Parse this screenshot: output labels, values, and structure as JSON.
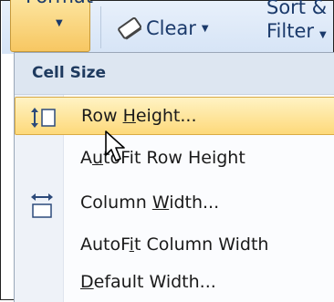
{
  "ribbon": {
    "format_label": "Format",
    "clear_label": "Clear",
    "sort_filter_line1": "Sort &",
    "sort_filter_line2": "Filter"
  },
  "menu": {
    "section_title": "Cell Size",
    "items": [
      {
        "pre": "Row ",
        "ul": "H",
        "post": "eight...",
        "highlighted": true,
        "icon": "row-height-icon"
      },
      {
        "pre": "A",
        "ul": "u",
        "post": "toFit Row Height",
        "highlighted": false,
        "icon": null
      },
      {
        "pre": "Column ",
        "ul": "W",
        "post": "idth...",
        "highlighted": false,
        "icon": "column-width-icon"
      },
      {
        "pre": "AutoF",
        "ul": "i",
        "post": "t Column Width",
        "highlighted": false,
        "icon": null
      },
      {
        "pre": "",
        "ul": "D",
        "post": "efault Width...",
        "highlighted": false,
        "icon": null
      }
    ]
  },
  "colors": {
    "highlight_top": "#fff3c4",
    "highlight_bottom": "#fdd97a",
    "ribbon_text": "#1b3a6b"
  }
}
